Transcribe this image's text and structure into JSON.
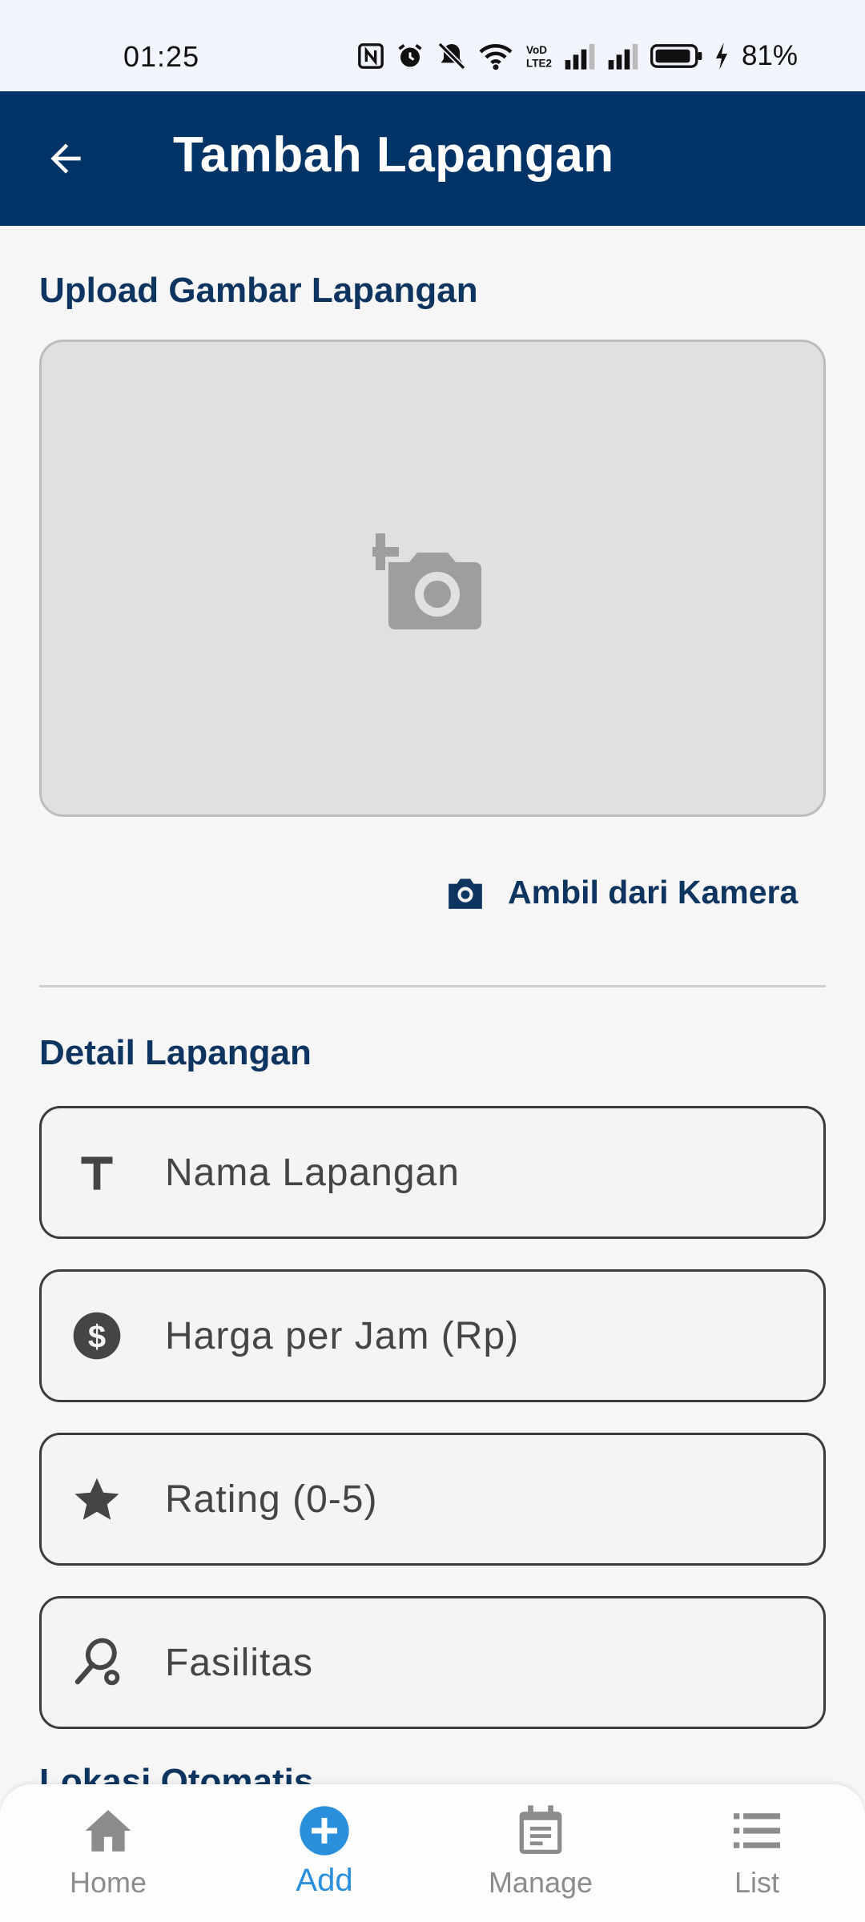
{
  "status_bar": {
    "time": "01:25",
    "battery_percent": "81%"
  },
  "app_bar": {
    "title": "Tambah Lapangan",
    "back_icon": "arrow-back-icon"
  },
  "upload_section": {
    "title": "Upload Gambar Lapangan",
    "placeholder_icon": "add-photo-icon",
    "camera_button_label": "Ambil dari Kamera"
  },
  "detail_section": {
    "title": "Detail Lapangan",
    "fields": [
      {
        "icon": "text-icon",
        "placeholder": "Nama Lapangan"
      },
      {
        "icon": "dollar-circle-icon",
        "placeholder": "Harga per Jam (Rp)"
      },
      {
        "icon": "star-icon",
        "placeholder": "Rating (0-5)"
      },
      {
        "icon": "racket-icon",
        "placeholder": "Fasilitas"
      }
    ]
  },
  "location_section": {
    "title": "Lokasi Otomatis"
  },
  "bottom_nav": {
    "items": [
      {
        "label": "Home",
        "icon": "home-icon",
        "active": false
      },
      {
        "label": "Add",
        "icon": "add-circle-icon",
        "active": true
      },
      {
        "label": "Manage",
        "icon": "calendar-note-icon",
        "active": false
      },
      {
        "label": "List",
        "icon": "list-icon",
        "active": false
      }
    ]
  },
  "colors": {
    "primary": "#003366",
    "accent": "#2a8fdc",
    "background": "#f6f6f6"
  }
}
